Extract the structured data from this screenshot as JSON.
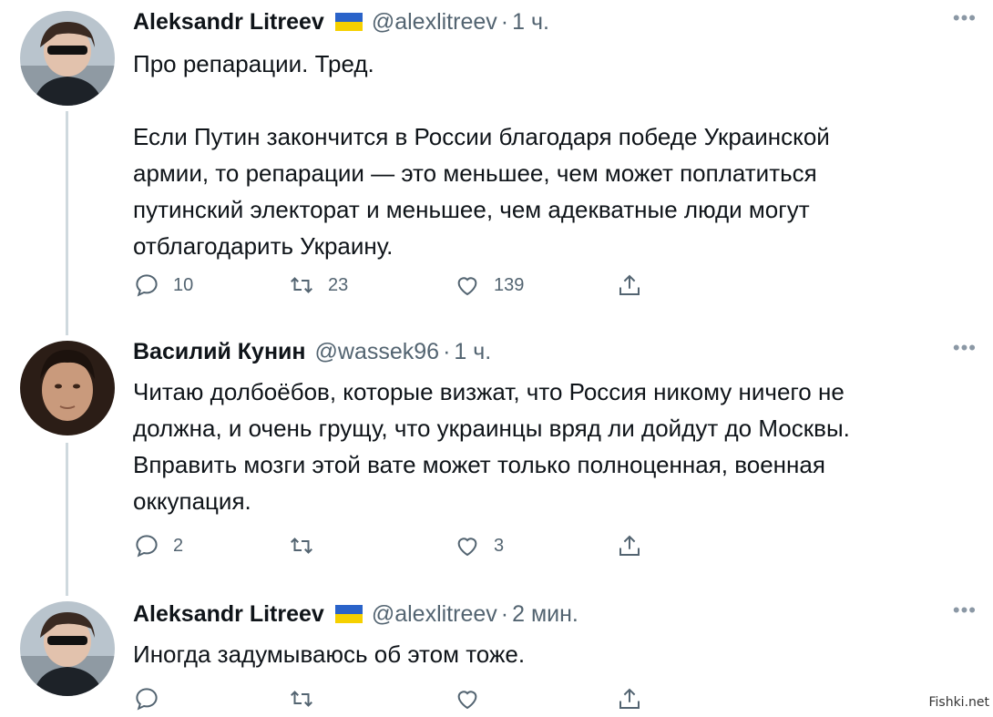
{
  "tweets": [
    {
      "name": "Aleksandr Litreev",
      "handle": "@alexlitreev",
      "time": "1 ч.",
      "text": "Про репарации. Тред.\n\nЕсли Путин закончится в России благодаря победе Украинской\nармии, то репарации — это меньшее, чем может поплатиться\nпутинский электорат и меньшее, чем адекватные люди могут\nотблагодарить Украину.",
      "replies": "10",
      "retweets": "23",
      "likes": "139"
    },
    {
      "name": "Василий Кунин",
      "handle": "@wassek96",
      "time": "1 ч.",
      "text": "Читаю долбоёбов, которые визжат, что Россия никому ничего не\nдолжна, и очень грущу, что украинцы вряд ли дойдут до Москвы.\nВправить мозги этой вате может только полноценная, военная\nоккупация.",
      "replies": "2",
      "retweets": "",
      "likes": "3"
    },
    {
      "name": "Aleksandr Litreev",
      "handle": "@alexlitreev",
      "time": "2 мин.",
      "text": "Иногда задумываюсь об этом тоже.",
      "replies": "",
      "retweets": "",
      "likes": ""
    }
  ],
  "dot": "·",
  "more": "•••",
  "watermark": "Fishki.net",
  "colors": {
    "text": "#0f1419",
    "muted": "#536471",
    "thread_line": "#cfd9de",
    "flag_blue": "#2a63c9",
    "flag_yellow": "#f5d000"
  },
  "icons": [
    "reply-icon",
    "retweet-icon",
    "like-icon",
    "share-icon",
    "more-icon"
  ]
}
